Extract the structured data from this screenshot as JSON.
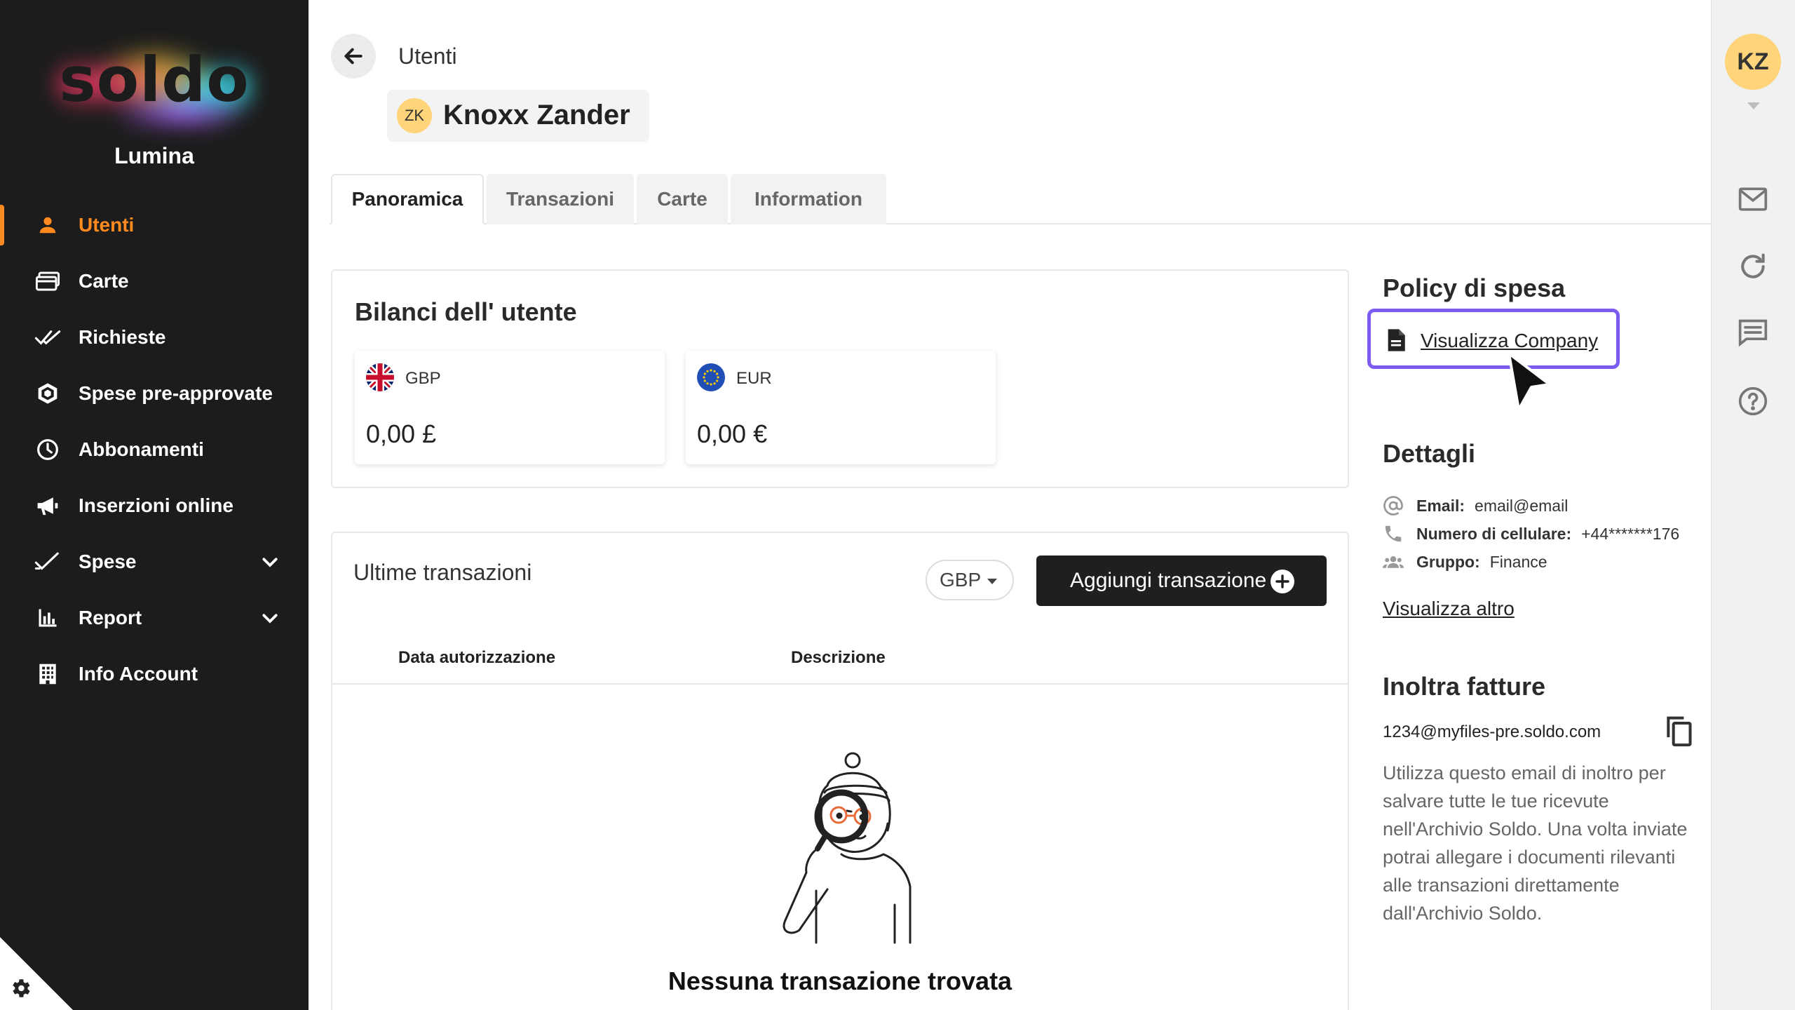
{
  "brand": {
    "logo_text": "soldo",
    "org_name": "Lumina",
    "accent": "#ff8a1f"
  },
  "sidebar": {
    "items": [
      {
        "label": "Utenti",
        "icon": "user-icon",
        "active": true
      },
      {
        "label": "Carte",
        "icon": "cards-icon"
      },
      {
        "label": "Richieste",
        "icon": "double-check-icon"
      },
      {
        "label": "Spese pre-approvate",
        "icon": "hexagon-icon"
      },
      {
        "label": "Abbonamenti",
        "icon": "clock-icon"
      },
      {
        "label": "Inserzioni online",
        "icon": "megaphone-icon"
      },
      {
        "label": "Spese",
        "icon": "check-icon",
        "expandable": true
      },
      {
        "label": "Report",
        "icon": "bar-chart-icon",
        "expandable": true
      },
      {
        "label": "Info Account",
        "icon": "building-icon"
      }
    ]
  },
  "header": {
    "breadcrumb": "Utenti",
    "user_initials": "ZK",
    "user_name": "Knoxx Zander"
  },
  "tabs": [
    {
      "label": "Panoramica",
      "active": true
    },
    {
      "label": "Transazioni"
    },
    {
      "label": "Carte"
    },
    {
      "label": "Information"
    }
  ],
  "balances": {
    "title": "Bilanci dell' utente",
    "items": [
      {
        "currency": "GBP",
        "amount": "0,00 £",
        "flag": "uk-flag-icon"
      },
      {
        "currency": "EUR",
        "amount": "0,00 €",
        "flag": "eu-flag-icon"
      }
    ]
  },
  "transactions": {
    "title": "Ultime transazioni",
    "currency_selected": "GBP",
    "add_button": "Aggiungi transazione",
    "columns": [
      "Data autorizzazione",
      "Descrizione"
    ],
    "empty_text": "Nessuna transazione trovata"
  },
  "policy": {
    "title": "Policy di spesa",
    "link": "Visualizza Company",
    "highlight_color": "#7c5cf0"
  },
  "details": {
    "title": "Dettagli",
    "rows": [
      {
        "label": "Email:",
        "value": "email@email",
        "icon": "at-icon"
      },
      {
        "label": "Numero di cellulare:",
        "value": "+44*******176",
        "icon": "phone-icon"
      },
      {
        "label": "Gruppo:",
        "value": "Finance",
        "icon": "group-icon"
      }
    ],
    "show_more": "Visualizza altro"
  },
  "forward_invoices": {
    "title": "Inoltra fatture",
    "email": "1234@myfiles-pre.soldo.com",
    "description": "Utilizza questo email di inoltro per salvare tutte le tue ricevute nell'Archivio Soldo. Una volta inviate potrai allegare i documenti rilevanti alle transazioni direttamente dall'Archivio Soldo."
  },
  "rail": {
    "avatar_initials": "KZ",
    "icons": [
      "mail-icon",
      "refresh-icon",
      "chat-icon",
      "help-icon"
    ]
  }
}
